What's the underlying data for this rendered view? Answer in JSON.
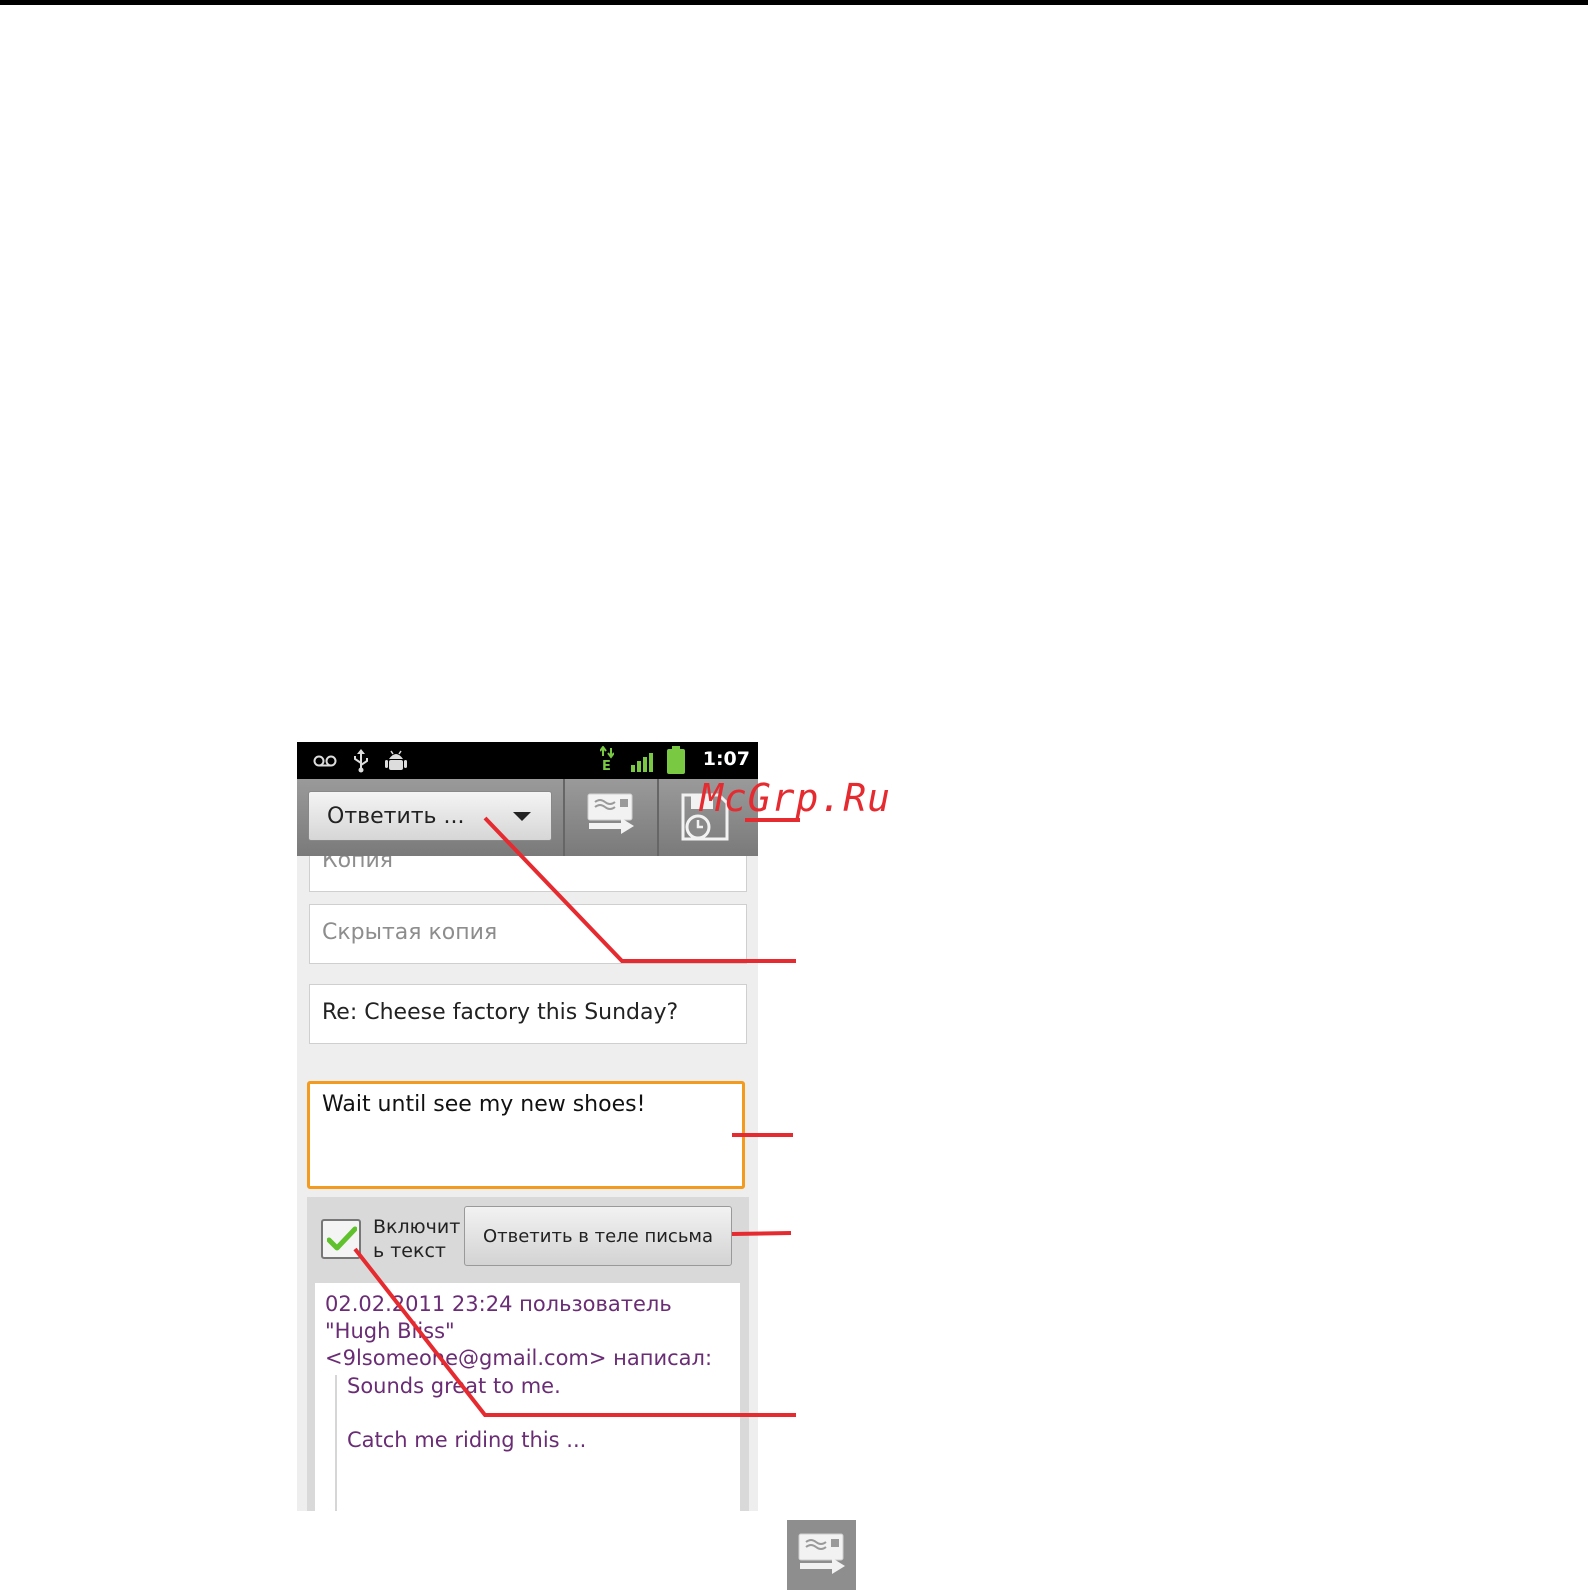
{
  "status_bar": {
    "time": "1:07",
    "network_label": "E",
    "icons": [
      "voicemail-icon",
      "usb-icon",
      "android-debug-icon",
      "data-transfer-icon",
      "signal-icon",
      "battery-icon"
    ]
  },
  "action_bar": {
    "reply_dropdown_label": "Ответить ...",
    "buttons": [
      "send-icon",
      "save-draft-icon"
    ]
  },
  "compose": {
    "cc_placeholder": "Копия",
    "bcc_placeholder": "Скрытая копия",
    "subject": "Re: Cheese factory this Sunday?",
    "body": "Wait until see my new shoes!"
  },
  "quote_options": {
    "include_text_line1": "Включит",
    "include_text_line2": "ь текст",
    "include_text_checked": true,
    "reply_inline_label": "Ответить в теле письма"
  },
  "quoted_message": {
    "header_line1": "02.02.2011 23:24 пользователь",
    "header_line2": "\"Hugh Bliss\"",
    "header_line3": "<9lsomeone@gmail.com> написал:",
    "quote_line1": "Sounds great to me.",
    "quote_line2": "Catch me riding this ..."
  },
  "watermark": "McGrp.Ru",
  "colors": {
    "accent_orange": "#f39a1f",
    "callout_red": "#e52a30",
    "quoted_text_purple": "#6a2c74",
    "status_green": "#7ac943"
  }
}
